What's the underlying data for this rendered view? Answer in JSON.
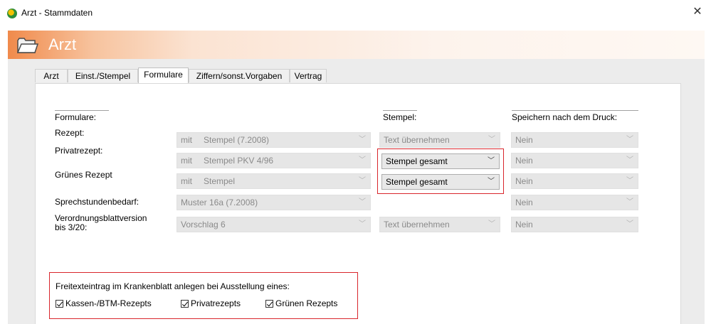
{
  "window": {
    "title": "Arzt - Stammdaten",
    "close_symbol": "✕"
  },
  "header": {
    "title": "Arzt",
    "icon": "folder-icon"
  },
  "tabs": [
    {
      "label": "Arzt"
    },
    {
      "label": "Einst./Stempel"
    },
    {
      "label": "Formulare",
      "active": true
    },
    {
      "label": "Ziffern/sonst.Vorgaben"
    },
    {
      "label": "Vertrag"
    }
  ],
  "columns": {
    "formulare": "Formulare:",
    "stempel": "Stempel:",
    "speichern": "Speichern nach dem Druck:"
  },
  "rows": [
    {
      "label": "Rezept:",
      "form_prefix": "mit",
      "form_value": "Stempel  (7.2008)",
      "stempel": "Text übernehmen",
      "speichern": "Nein"
    },
    {
      "label": "Privatrezept:",
      "form_prefix": "mit",
      "form_value": "Stempel PKV 4/96",
      "stempel": "Stempel gesamt",
      "speichern": "Nein"
    },
    {
      "label": "Grünes Rezept",
      "form_prefix": "mit",
      "form_value": "Stempel",
      "stempel": "Stempel gesamt",
      "speichern": "Nein"
    },
    {
      "label": "Sprechstundenbedarf:",
      "form_prefix": "",
      "form_value": "Muster 16a (7.2008)",
      "stempel": "",
      "speichern": "Nein"
    },
    {
      "label_line1": "Verordnungsblattversion",
      "label_line2": "bis 3/20:",
      "form_prefix": "",
      "form_value": "Vorschlag 6",
      "stempel": "Text übernehmen",
      "speichern": "Nein"
    }
  ],
  "freitext": {
    "caption": "Freitexteintrag im Krankenblatt anlegen bei Ausstellung eines:",
    "options": [
      {
        "label": "Kassen-/BTM-Rezepts",
        "checked": true
      },
      {
        "label": "Privatrezepts",
        "checked": true
      },
      {
        "label": "Grünen Rezepts",
        "checked": true
      }
    ]
  },
  "colors": {
    "highlight_border": "#d9262c",
    "header_gradient_start": "#f08a4b"
  }
}
